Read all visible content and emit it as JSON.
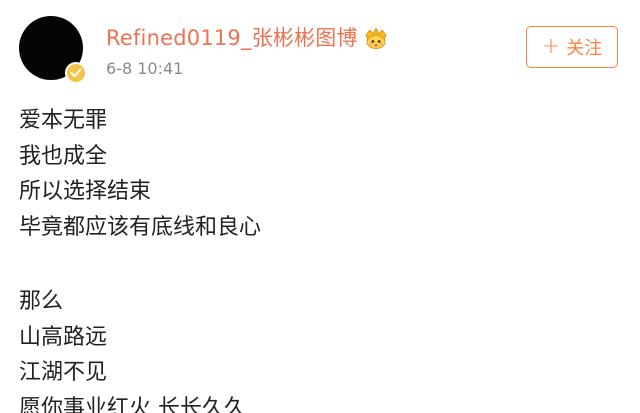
{
  "post": {
    "username": "Refined0119_张彬彬图博",
    "timestamp": "6-8 10:41",
    "follow_label": "关注",
    "follow_icon": "+",
    "icons": {
      "badge": "verified-badge-icon",
      "crown": "crown-emoji-icon"
    },
    "colors": {
      "username": "#eb7350",
      "follow": "#ff8140",
      "badge": "#f6c34a",
      "text": "#222222",
      "timestamp": "#8a8a8a"
    },
    "lines": [
      "爱本无罪",
      "我也成全",
      "所以选择结束",
      "毕竟都应该有底线和良心",
      "",
      "那么",
      "山高路远",
      "江湖不见",
      "愿你事业红火 长长久久"
    ]
  }
}
